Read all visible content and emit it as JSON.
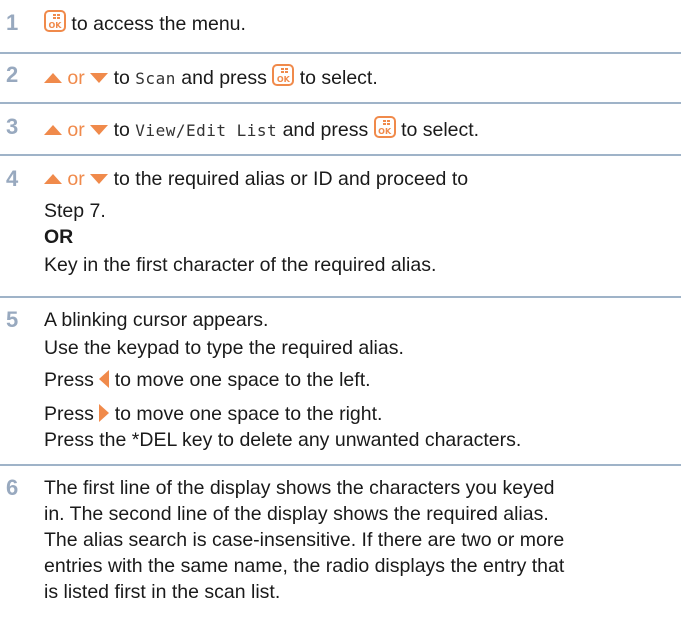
{
  "colors": {
    "accent": "#f08a4b",
    "step_number": "#98a9bf",
    "divider": "#9fb3c8",
    "text": "#1a1a1a"
  },
  "icons": {
    "ok_key": "menu-ok-key-icon",
    "up": "up-arrow-icon",
    "down": "down-arrow-icon",
    "left": "left-arrow-icon",
    "right": "right-arrow-icon"
  },
  "key_ok_label": "OK",
  "or_word": "or",
  "steps": [
    {
      "number": "1",
      "text": "to access the menu."
    },
    {
      "number": "2",
      "text_to": "to",
      "menu_item": "Scan",
      "text_press": "and press",
      "text_select": "to select."
    },
    {
      "number": "3",
      "text_to": "to",
      "menu_item": "View/Edit List",
      "text_press": "and press",
      "text_select": "to select."
    },
    {
      "number": "4",
      "line1": "to the required alias or ID and proceed to",
      "line2": "Step 7.",
      "or_label": "OR",
      "line4": "Key in the first character of the required alias."
    },
    {
      "number": "5",
      "line1": "A blinking cursor appears.",
      "line2": "Use the keypad to type the required alias.",
      "press": "Press",
      "left_text": "to move one space to the left.",
      "right_text": "to move one space to the right.",
      "line5": "Press the *DEL key to delete any unwanted characters."
    },
    {
      "number": "6",
      "lines": [
        "The first line of the display shows the characters you keyed",
        "in. The second line of the display shows the required alias.",
        "The alias search is case-insensitive. If there are two or more",
        "entries with the same name, the radio displays the entry that",
        "is listed first in the scan list."
      ]
    }
  ]
}
